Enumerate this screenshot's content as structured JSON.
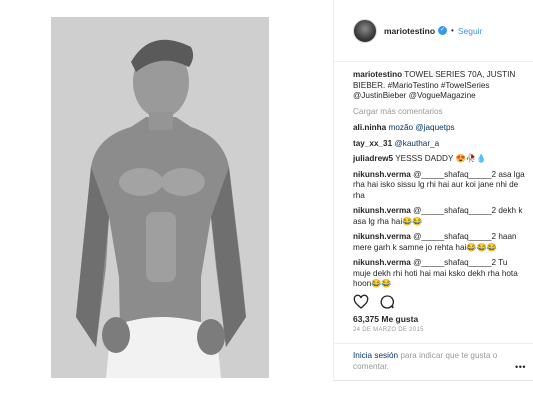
{
  "post": {
    "author": "mariotestino",
    "follow_label": "Seguir",
    "dot": "•",
    "caption_text": "TOWEL SERIES 70A, JUSTIN BIEBER. #MarioTestino #TowelSeries @JustinBieber @VogueMagazine",
    "load_more": "Cargar más comentarios",
    "comments": [
      {
        "user": "ali.ninha",
        "text": "mozão @jaquetps"
      },
      {
        "user": "tay_xx_31",
        "text": "@kauthar_a"
      },
      {
        "user": "juliadrew5",
        "text": "YESSS DADDY 😍🥀💧"
      },
      {
        "user": "nikunsh.verma",
        "text": "@_____shafaq_____2 asa lga rha hai isko sissu lg rhi hai aur koi jane nhi de rha"
      },
      {
        "user": "nikunsh.verma",
        "text": "@_____shafaq_____2 dekh k asa lg rha hai😂😂"
      },
      {
        "user": "nikunsh.verma",
        "text": "@_____shafaq_____2 haan mere garh k samne jo rehta hai😂😂😂"
      },
      {
        "user": "nikunsh.verma",
        "text": "@_____shafaq_____2 Tu muje dekh rhi hoti hai mai ksko dekh rha hota hoon😂😂"
      }
    ],
    "likes": "63,375 Me gusta",
    "date": "24 DE MARZO DE 2015",
    "login_link": "Inicia sesión",
    "login_text": " para indicar que te gusta o comentar.",
    "more_label": "•••",
    "verified_glyph": "✓"
  },
  "icons": {
    "like": "heart-icon",
    "comment": "comment-icon",
    "verified": "verified-badge-icon",
    "more": "more-options-icon"
  },
  "colors": {
    "link_blue": "#3897f0",
    "dark_link": "#003569",
    "muted": "#999999"
  }
}
